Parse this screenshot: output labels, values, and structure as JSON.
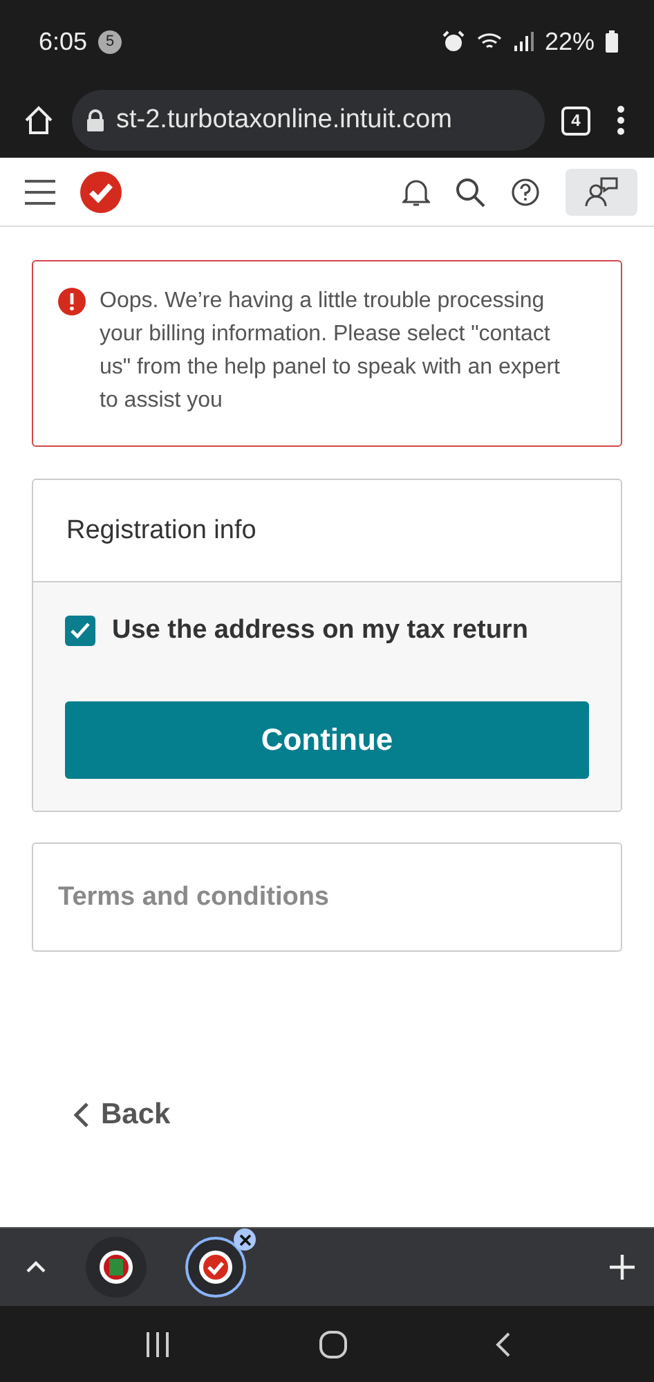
{
  "status_bar": {
    "time": "6:05",
    "notification_count": "5",
    "battery": "22%"
  },
  "browser": {
    "url": "st-2.turbotaxonline.intuit.com",
    "tab_count": "4"
  },
  "alert": {
    "message": "Oops. We’re having a little trouble processing your billing information. Please select \"contact us\" from the help panel to speak with an expert to assist you"
  },
  "registration": {
    "title": "Registration info",
    "checkbox": {
      "label": "Use the address on my tax return",
      "checked": true
    },
    "button": "Continue"
  },
  "terms": {
    "title": "Terms and conditions"
  },
  "back": {
    "label": "Back"
  },
  "tab_strip": {
    "tabs": [
      {
        "selected": false
      },
      {
        "selected": true
      }
    ]
  }
}
